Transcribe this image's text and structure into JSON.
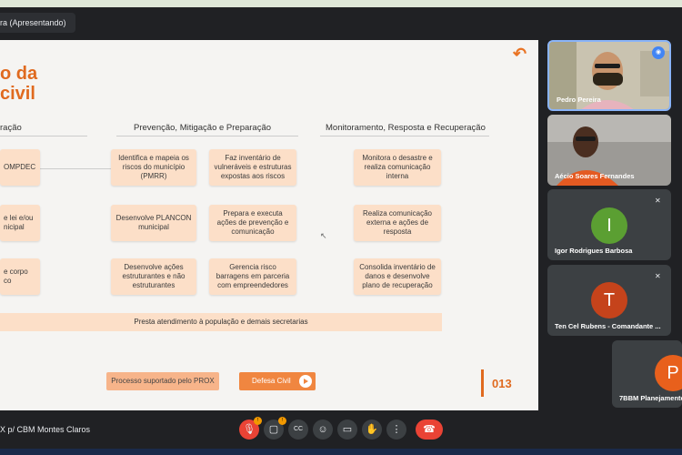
{
  "presenter_label": "ra (Apresentando)",
  "slide": {
    "title_line1": "o da",
    "title_line2": "civil",
    "col_left": "ração",
    "col_mid": "Prevenção, Mitigação e Preparação",
    "col_right": "Monitoramento, Resposta e Recuperação",
    "left_boxes": [
      "OMPDEC",
      "e lei e/ou\nnicipal",
      "e corpo\nco"
    ],
    "mid_boxes": [
      "Identifica e mapeia os riscos do município (PMRR)",
      "Faz inventário de vulneráveis e estruturas expostas aos riscos",
      "Desenvolve PLANCON municipal",
      "Prepara e executa ações de prevenção e comunicação",
      "Desenvolve ações estruturantes e não estruturantes",
      "Gerencia risco barragens em parceria com empreendedores"
    ],
    "right_boxes": [
      "Monitora o desastre e realiza comunicação interna",
      "Realiza comunicação externa e ações de resposta",
      "Consolida inventário de danos e desenvolve plano de recuperação"
    ],
    "bar_text": "Presta atendimento à população e demais secretarias",
    "btn_prox": "Processo suportado pelo PROX",
    "btn_defesa": "Defesa Civil",
    "page_number": "013"
  },
  "participants": [
    {
      "name": "Pedro Pereira",
      "initial": "",
      "color": ""
    },
    {
      "name": "Aécio Soares Fernandes",
      "initial": "",
      "color": ""
    },
    {
      "name": "Igor Rodrigues Barbosa",
      "initial": "I",
      "color": "#5b9f32"
    },
    {
      "name": "Ten Cel Rubens - Comandante ...",
      "initial": "T",
      "color": "#c5431b"
    },
    {
      "name": "7BBM Planejamento",
      "initial": "P",
      "color": "#e8601c"
    }
  ],
  "meeting_name": "X p/ CBM Montes Claros",
  "controls": {
    "mic_badge": "!",
    "cam_badge": "!",
    "captions": "CC",
    "emoji": "☺",
    "present": "▭",
    "raise_hand": "✋",
    "more": "⋮"
  },
  "colors": {
    "accent": "#e06a1f",
    "box": "#fcdfc8",
    "end_call": "#ea4335"
  }
}
